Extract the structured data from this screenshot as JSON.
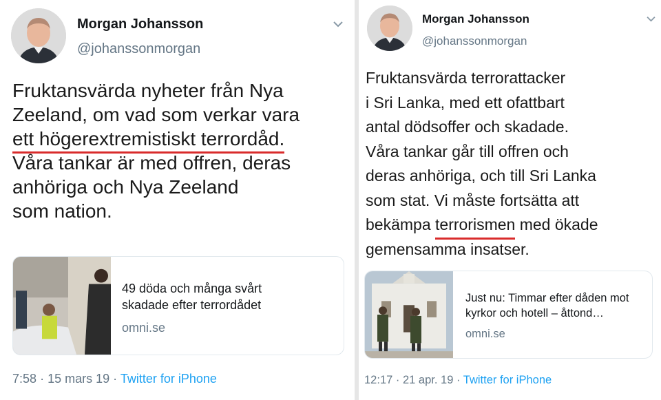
{
  "tweets": [
    {
      "name": "Morgan Johansson",
      "handle": "@johanssonmorgan",
      "lines": [
        {
          "text": "Fruktansvärda nyheter från Nya"
        },
        {
          "text": "Zeeland, om vad som verkar vara"
        },
        {
          "pre": "",
          "u": "ett högerextremistiskt terrordåd.",
          "post": ""
        },
        {
          "text": "Våra tankar är med offren, deras"
        },
        {
          "text": "anhöriga och Nya Zeeland"
        },
        {
          "text": "som nation."
        }
      ],
      "card": {
        "title": "49 döda och många svårt skadade efter terrordådet",
        "domain": "omni.se"
      },
      "time": "7:58",
      "date": "15 mars 19",
      "source": "Twitter for iPhone"
    },
    {
      "name": "Morgan Johansson",
      "handle": "@johanssonmorgan",
      "lines": [
        {
          "text": "Fruktansvärda terrorattacker"
        },
        {
          "text": "i Sri Lanka, med ett ofattbart"
        },
        {
          "text": "antal dödsoffer och skadade."
        },
        {
          "text": "Våra tankar går till offren och"
        },
        {
          "text": "deras anhöriga, och till Sri Lanka"
        },
        {
          "text": "som stat. Vi måste fortsätta att"
        },
        {
          "pre": "bekämpa ",
          "u": "terrorismen",
          "post": " med ökade"
        },
        {
          "text": "gemensamma insatser."
        }
      ],
      "card": {
        "title": "Just nu: Timmar efter dåden mot kyrkor och hotell – åttond…",
        "domain": "omni.se"
      },
      "time": "12:17",
      "date": "21 apr. 19",
      "source": "Twitter for iPhone"
    }
  ],
  "separator": "·",
  "icons": {
    "menu": "chevron-down-icon"
  },
  "colors": {
    "underline": "#d92b2b",
    "link": "#1da1f2",
    "muted": "#657786"
  }
}
